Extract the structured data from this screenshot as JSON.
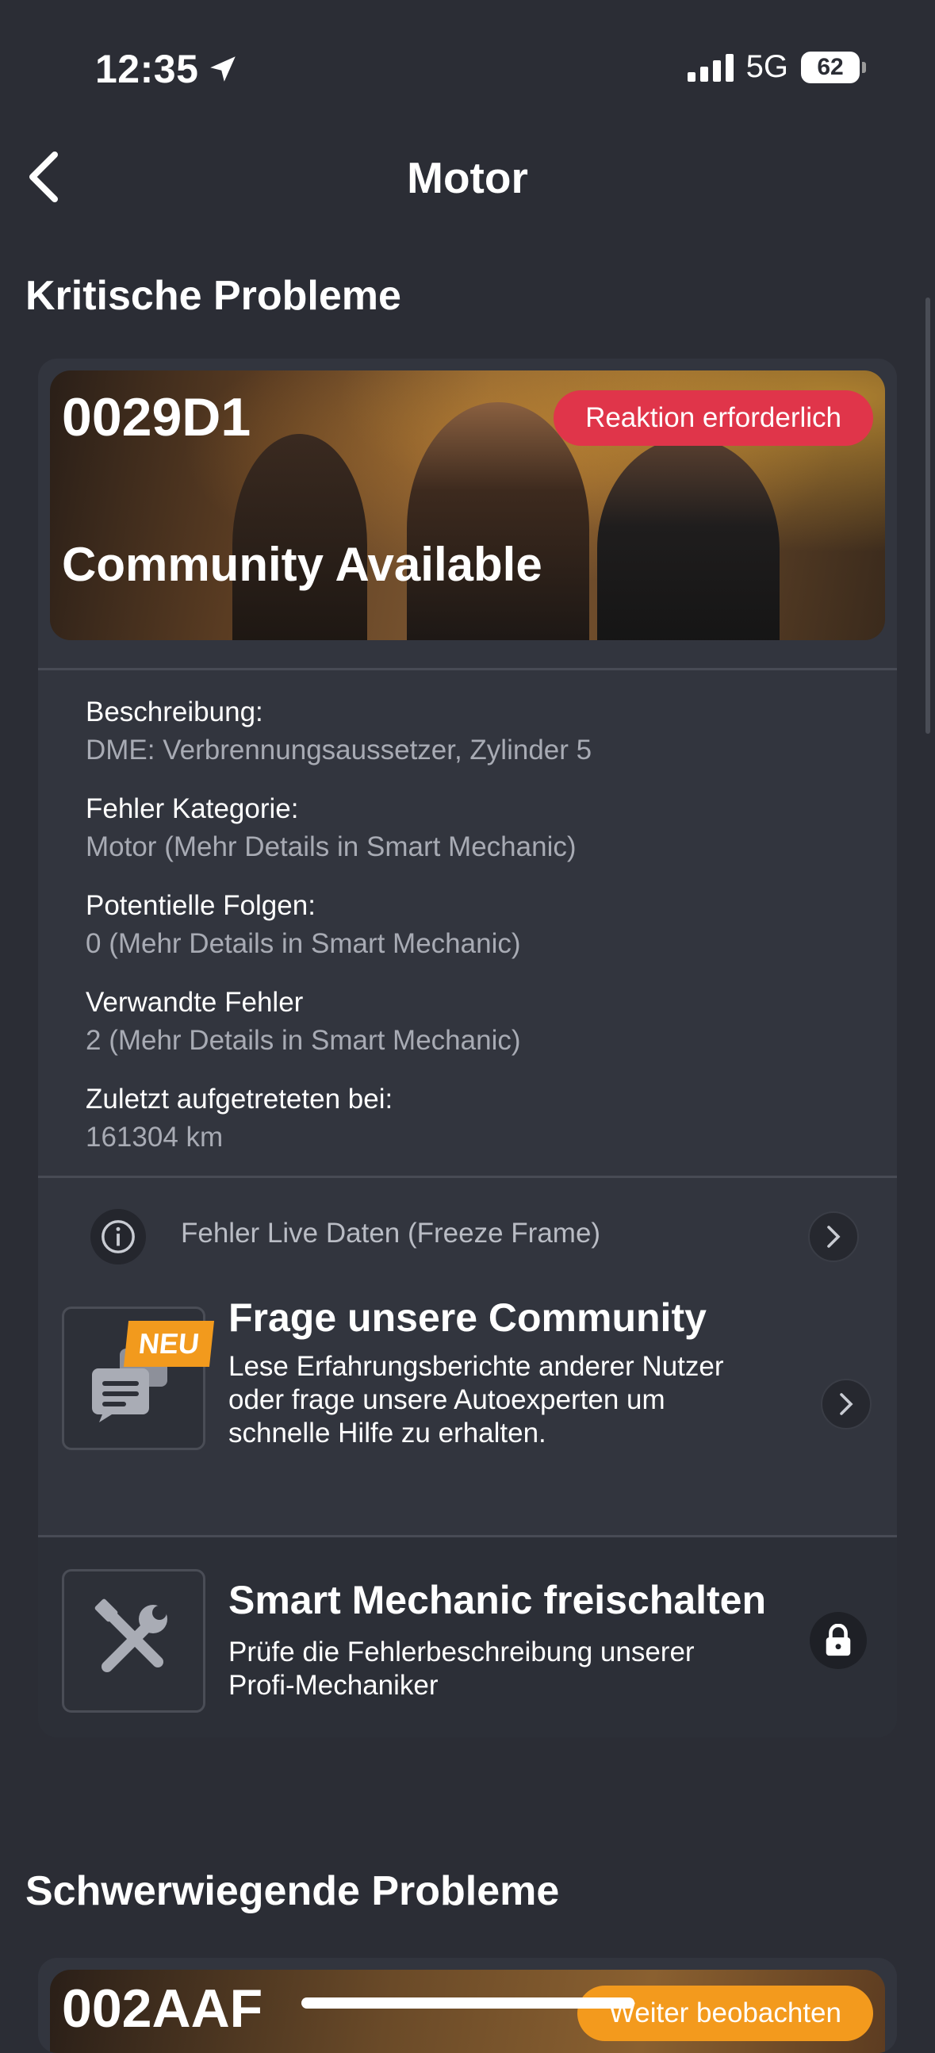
{
  "status_bar": {
    "time": "12:35",
    "network": "5G",
    "battery": "62"
  },
  "nav": {
    "title": "Motor"
  },
  "sections": {
    "critical": "Kritische Probleme",
    "severe": "Schwerwiegende Probleme"
  },
  "critical_card": {
    "code": "0029D1",
    "badge": "Reaktion erforderlich",
    "subtitle": "Community Available",
    "fields": [
      {
        "label": "Beschreibung:",
        "value": "DME: Verbrennungsaussetzer, Zylinder 5"
      },
      {
        "label": "Fehler Kategorie:",
        "value": "Motor (Mehr Details in Smart Mechanic)"
      },
      {
        "label": "Potentielle Folgen:",
        "value": "0 (Mehr Details in Smart Mechanic)"
      },
      {
        "label": "Verwandte Fehler",
        "value": "2 (Mehr Details in Smart Mechanic)"
      },
      {
        "label": "Zuletzt aufgetreteten bei:",
        "value": "161304 km"
      }
    ],
    "live_data_label": "Fehler Live Daten (Freeze Frame)",
    "community": {
      "badge": "NEU",
      "title": "Frage unsere Community",
      "desc_lines": [
        "Lese Erfahrungsberichte anderer Nutzer",
        "oder frage unsere Autoexperten um",
        "schnelle Hilfe zu erhalten."
      ]
    },
    "smart_mechanic": {
      "title": "Smart Mechanic freischalten",
      "desc_lines": [
        "Prüfe die Fehlerbeschreibung unserer",
        "Profi-Mechaniker"
      ]
    }
  },
  "severe_card": {
    "code": "002AAF",
    "badge": "Weiter beobachten"
  },
  "colors": {
    "background": "#2b2d35",
    "card": "#32353e",
    "alert_red": "#e0354a",
    "accent_orange": "#f39a1d"
  }
}
